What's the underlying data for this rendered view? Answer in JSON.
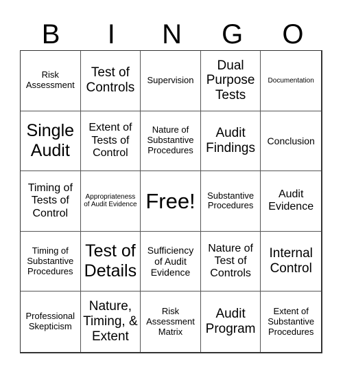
{
  "header": {
    "letters": [
      "B",
      "I",
      "N",
      "G",
      "O"
    ]
  },
  "cells": [
    {
      "text": "Risk Assessment",
      "size": "s-sm"
    },
    {
      "text": "Test of Controls",
      "size": "s-xl"
    },
    {
      "text": "Supervision",
      "size": "s-sm"
    },
    {
      "text": "Dual Purpose Tests",
      "size": "s-xl"
    },
    {
      "text": "Documentation",
      "size": "s-xs"
    },
    {
      "text": "Single Audit",
      "size": "s-xxl"
    },
    {
      "text": "Extent of Tests of Control",
      "size": "s-lg"
    },
    {
      "text": "Nature of Substantive Procedures",
      "size": "s-sm"
    },
    {
      "text": "Audit Findings",
      "size": "s-xl"
    },
    {
      "text": "Conclusion",
      "size": "s-md"
    },
    {
      "text": "Timing of Tests of Control",
      "size": "s-lg"
    },
    {
      "text": "Appropriateness of Audit Evidence",
      "size": "s-xs"
    },
    {
      "text": "Free!",
      "size": "s-free"
    },
    {
      "text": "Substantive Procedures",
      "size": "s-sm"
    },
    {
      "text": "Audit Evidence",
      "size": "s-lg"
    },
    {
      "text": "Timing of Substantive Procedures",
      "size": "s-sm"
    },
    {
      "text": "Test of Details",
      "size": "s-xxl"
    },
    {
      "text": "Sufficiency of Audit Evidence",
      "size": "s-md"
    },
    {
      "text": "Nature of Test of Controls",
      "size": "s-lg"
    },
    {
      "text": "Internal Control",
      "size": "s-xl"
    },
    {
      "text": "Professional Skepticism",
      "size": "s-sm"
    },
    {
      "text": "Nature, Timing, & Extent",
      "size": "s-xl"
    },
    {
      "text": "Risk Assessment Matrix",
      "size": "s-sm"
    },
    {
      "text": "Audit Program",
      "size": "s-xl"
    },
    {
      "text": "Extent of Substantive Procedures",
      "size": "s-sm"
    }
  ]
}
